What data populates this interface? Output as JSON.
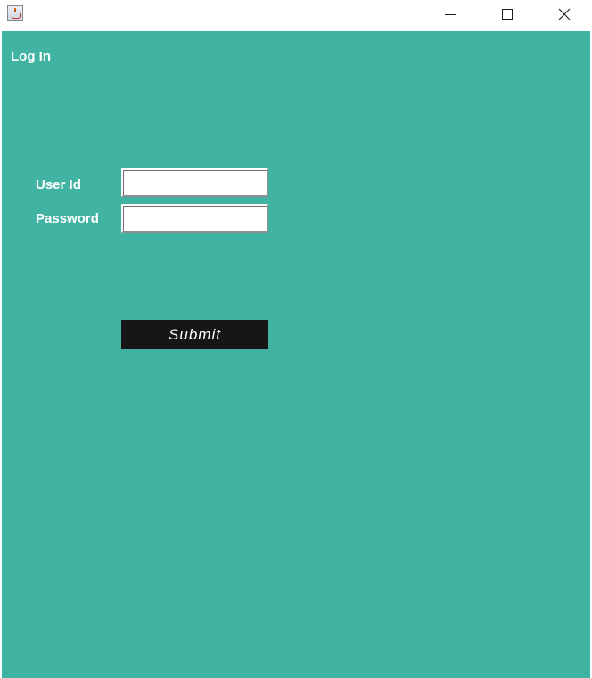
{
  "window": {
    "controls": {
      "minimize_icon": "minimize-icon",
      "maximize_icon": "maximize-icon",
      "close_icon": "close-icon"
    }
  },
  "form": {
    "title": "Log In",
    "user_id_label": "User Id",
    "password_label": "Password",
    "user_id_value": "",
    "password_value": "",
    "submit_label": "Submit"
  },
  "colors": {
    "background": "#41b3a3",
    "button": "#161616",
    "text": "#ffffff"
  }
}
